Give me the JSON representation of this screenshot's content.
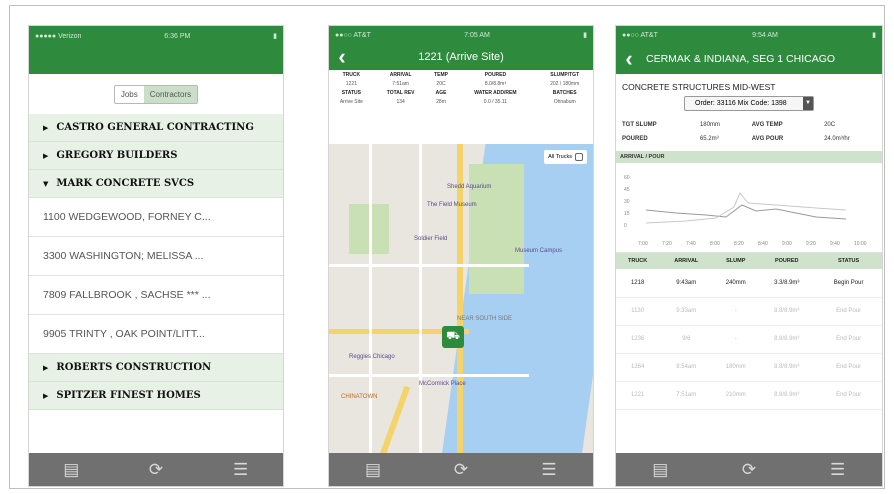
{
  "phone1": {
    "status": {
      "left": "●●●●● Verizon",
      "time": "6:36 PM",
      "right": "▮"
    },
    "tabs": [
      "Jobs",
      "Contractors"
    ],
    "groups_top": [
      {
        "label": "CASTRO GENERAL CONTRACTING",
        "expanded": false
      },
      {
        "label": "GREGORY BUILDERS",
        "expanded": false
      },
      {
        "label": "MARK CONCRETE SVCS",
        "expanded": true
      }
    ],
    "jobs": [
      "1100 WEDGEWOOD, FORNEY C...",
      "3300 WASHINGTON; MELISSA ...",
      "7809 FALLBROOK , SACHSE *** ...",
      "9905 TRINTY , OAK POINT/LITT..."
    ],
    "groups_bottom": [
      {
        "label": "ROBERTS CONSTRUCTION",
        "expanded": false
      },
      {
        "label": "SPITZER FINEST HOMES",
        "expanded": false
      }
    ]
  },
  "phone2": {
    "status": {
      "left": "●●○○ AT&T",
      "time": "7:05 AM",
      "right": "▮"
    },
    "title": "1221 (Arrive Site)",
    "headers1": [
      "TRUCK",
      "ARRIVAL",
      "TEMP",
      "POURED",
      "SLUMP/TGT"
    ],
    "values1": [
      "1221",
      "7:51am",
      "20C",
      "8.0/8.8m³",
      "202 / 180mm"
    ],
    "headers2": [
      "STATUS",
      "TOTAL REV",
      "AGE",
      "WATER ADD/REM",
      "BATCHES"
    ],
    "values2": [
      "Arrive Site",
      "134",
      "28m",
      "0.0 / 35.11",
      "Ohnabum"
    ],
    "all_trucks": "All Trucks",
    "map_labels": [
      "Shedd Aquarium",
      "The Field Museum",
      "Soldier Field",
      "Museum Campus",
      "Reggies Chicago",
      "McCormick Place",
      "CHINATOWN",
      "NEAR SOUTH SIDE"
    ]
  },
  "phone3": {
    "status": {
      "left": "●●○○ AT&T",
      "time": "9:54 AM",
      "right": "▮"
    },
    "title": "CERMAK & INDIANA, SEG 1 CHICAGO",
    "company": "CONCRETE STRUCTURES MID-WEST",
    "order": "Order: 33116 Mix Code: 1398",
    "stats": [
      {
        "k1": "TGT SLUMP",
        "v1": "180mm",
        "k2": "AVG TEMP",
        "v2": "20C"
      },
      {
        "k1": "POURED",
        "v1": "65.2m³",
        "k2": "AVG POUR",
        "v2": "24.0m³/hr"
      }
    ],
    "section": "ARRIVAL / POUR",
    "chart_y_ticks": [
      "60",
      "45",
      "30",
      "15",
      "0"
    ],
    "chart_x_ticks": [
      "7:00",
      "7:20",
      "7:40",
      "8:00",
      "8:20",
      "8:40",
      "9:00",
      "9:20",
      "9:40",
      "10:00"
    ],
    "table_headers": [
      "TRUCK",
      "ARRIVAL",
      "SLUMP",
      "POURED",
      "STATUS"
    ],
    "rows": [
      [
        "1218",
        "9:43am",
        "240mm",
        "3.3/8.9m³",
        "Begin Pour"
      ],
      [
        "1130",
        "9:33am",
        "-",
        "8.8/8.9m³",
        "End Pour"
      ],
      [
        "1236",
        "9/6",
        "-",
        "8.8/8.9m³",
        "End Pour"
      ],
      [
        "1264",
        "8:54am",
        "180mm",
        "8.8/8.9m³",
        "End Pour"
      ],
      [
        "1221",
        "7:51am",
        "210mm",
        "8.8/8.9m³",
        "End Pour"
      ]
    ]
  },
  "tabbar_icons": [
    "list-icon",
    "refresh-icon",
    "menu-icon"
  ],
  "colors": {
    "green": "#2e8b3e",
    "light_green": "#e7f1e5",
    "tabbar": "#707070"
  }
}
